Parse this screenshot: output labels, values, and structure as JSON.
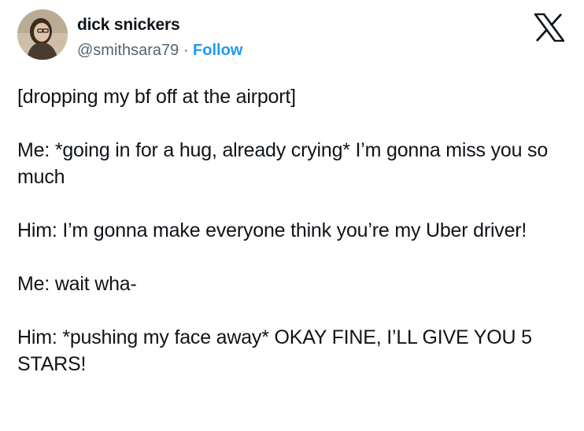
{
  "author": {
    "display_name": "dick snickers",
    "handle": "@smithsara79",
    "separator": "·",
    "follow_label": "Follow",
    "avatar_icon": "user-avatar-photo"
  },
  "brand": {
    "logo_icon": "x-logo-icon",
    "follow_color": "#1d9bf0",
    "handle_color": "#536471",
    "text_color": "#0f1419"
  },
  "tweet": {
    "paragraphs": [
      "[dropping my bf off at the airport]",
      "Me: *going in for a hug, already crying* I’m gonna miss you so much",
      "Him: I’m gonna make everyone think you’re my Uber driver!",
      "Me: wait wha-",
      "Him: *pushing my face away* OKAY FINE, I’LL GIVE YOU 5 STARS!"
    ]
  }
}
